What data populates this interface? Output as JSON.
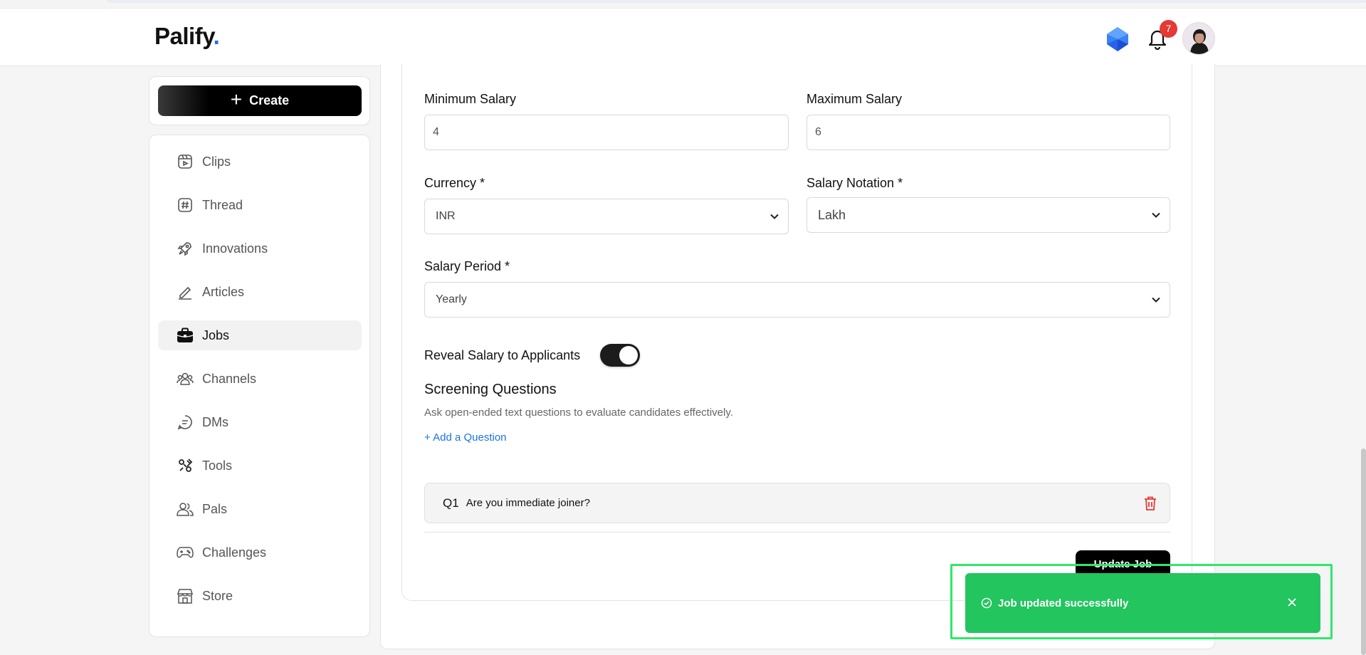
{
  "header": {
    "logo_text": "Palify",
    "logo_dot": ".",
    "notification_count": "7"
  },
  "sidebar": {
    "create_label": "Create",
    "items": [
      {
        "label": "Clips",
        "icon": "clips-icon"
      },
      {
        "label": "Thread",
        "icon": "hash-icon"
      },
      {
        "label": "Innovations",
        "icon": "rocket-icon"
      },
      {
        "label": "Articles",
        "icon": "pen-icon"
      },
      {
        "label": "Jobs",
        "icon": "briefcase-icon",
        "active": true
      },
      {
        "label": "Channels",
        "icon": "people-icon"
      },
      {
        "label": "DMs",
        "icon": "chat-icon"
      },
      {
        "label": "Tools",
        "icon": "tools-icon"
      },
      {
        "label": "Pals",
        "icon": "users-icon"
      },
      {
        "label": "Challenges",
        "icon": "gamepad-icon"
      },
      {
        "label": "Store",
        "icon": "store-icon"
      }
    ]
  },
  "form": {
    "min_salary_label": "Minimum Salary",
    "min_salary_value": "4",
    "max_salary_label": "Maximum Salary",
    "max_salary_value": "6",
    "currency_label": "Currency *",
    "currency_value": "INR",
    "notation_label": "Salary Notation *",
    "notation_value": "Lakh",
    "period_label": "Salary Period *",
    "period_value": "Yearly",
    "reveal_label": "Reveal Salary to Applicants",
    "reveal_on": true
  },
  "screening": {
    "title": "Screening Questions",
    "subtitle": "Ask open-ended text questions to evaluate candidates effectively.",
    "add_label": "+ Add a Question",
    "questions": [
      {
        "num": "Q1",
        "text": "Are you immediate joiner?"
      }
    ]
  },
  "actions": {
    "update_label": "Update Job"
  },
  "toast": {
    "message": "Job updated successfully",
    "color": "#22c55e"
  }
}
